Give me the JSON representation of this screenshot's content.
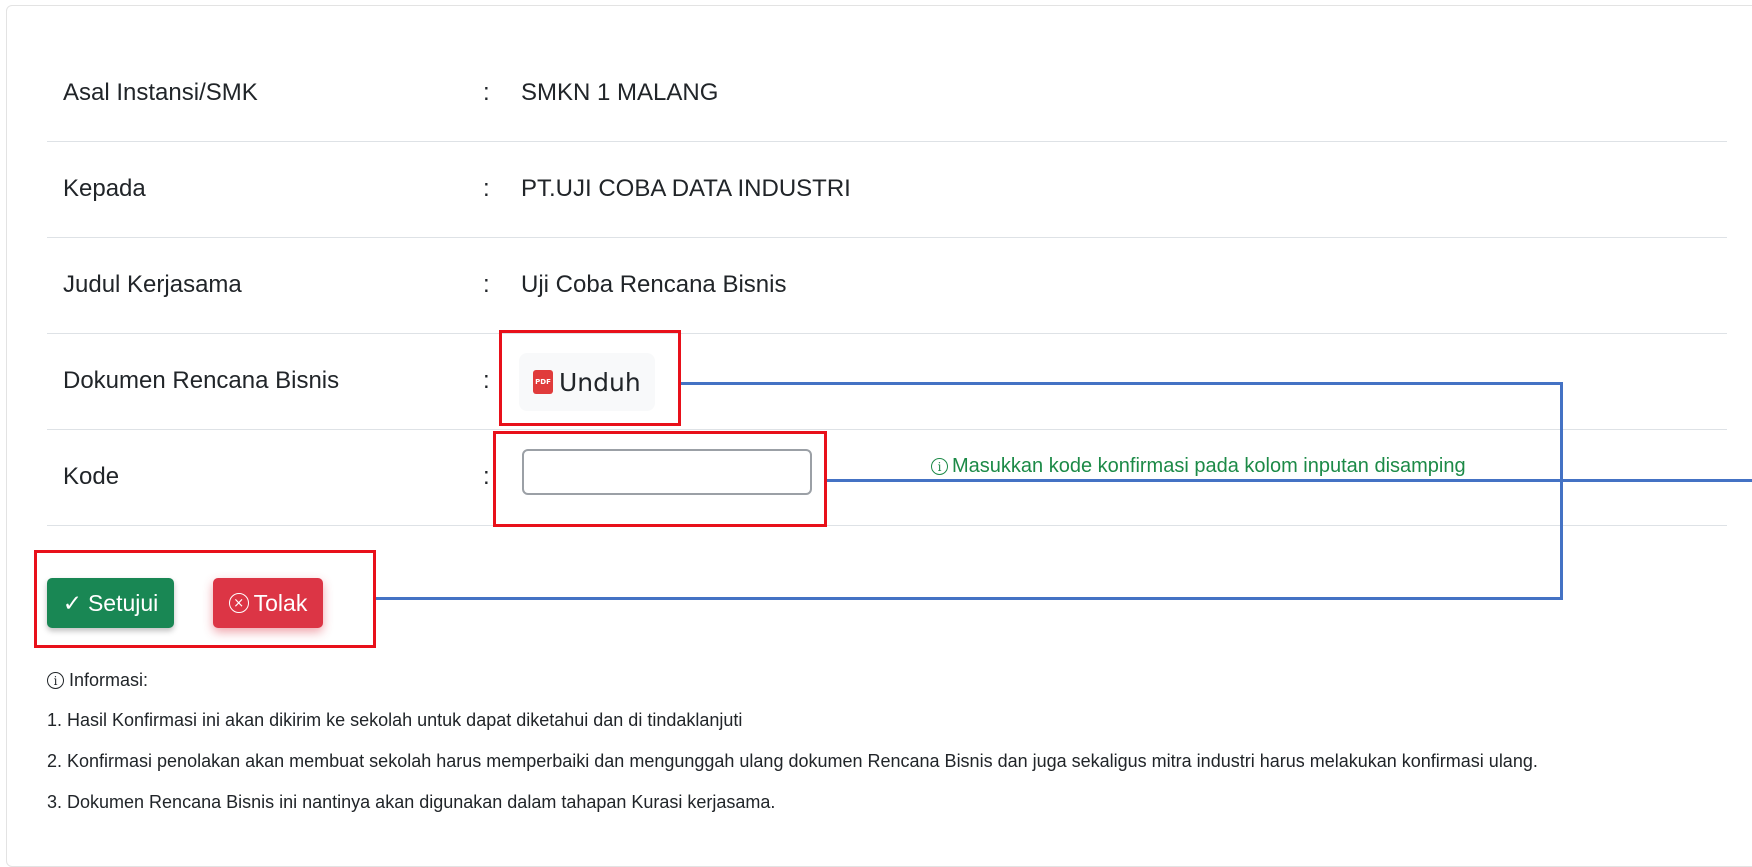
{
  "fields": [
    {
      "label": "Asal Instansi/SMK",
      "colon": ":",
      "value": "SMKN 1 MALANG"
    },
    {
      "label": "Kepada",
      "colon": ":",
      "value": "PT.UJI COBA DATA INDUSTRI"
    },
    {
      "label": "Judul Kerjasama",
      "colon": ":",
      "value": "Uji Coba Rencana Bisnis"
    },
    {
      "label": "Dokumen Rencana Bisnis",
      "colon": ":",
      "button_label": "Unduh",
      "icon_text": "PDF"
    },
    {
      "label": "Kode",
      "colon": ":",
      "input_value": "",
      "placeholder": ""
    }
  ],
  "hint": {
    "icon": "i",
    "text": "Masukkan kode konfirmasi pada kolom inputan disamping",
    "color": "#1c8a47"
  },
  "actions": {
    "approve_label": "Setujui",
    "approve_icon": "✓",
    "approve_color": "#198754",
    "reject_label": "Tolak",
    "reject_icon": "×",
    "reject_color": "#dc3545"
  },
  "info": {
    "icon": "i",
    "title": "Informasi:",
    "items": [
      "1. Hasil Konfirmasi ini akan dikirim ke sekolah untuk dapat diketahui dan di tindaklanjuti",
      "2. Konfirmasi penolakan akan membuat sekolah harus memperbaiki dan mengunggah ulang dokumen Rencana Bisnis dan juga sekaligus mitra industri harus melakukan konfirmasi ulang.",
      "3. Dokumen Rencana Bisnis ini nantinya akan digunakan dalam tahapan Kurasi kerjasama."
    ]
  },
  "annotation_colors": {
    "highlight_box": "#e8101a",
    "connector_line": "#4472c4"
  }
}
